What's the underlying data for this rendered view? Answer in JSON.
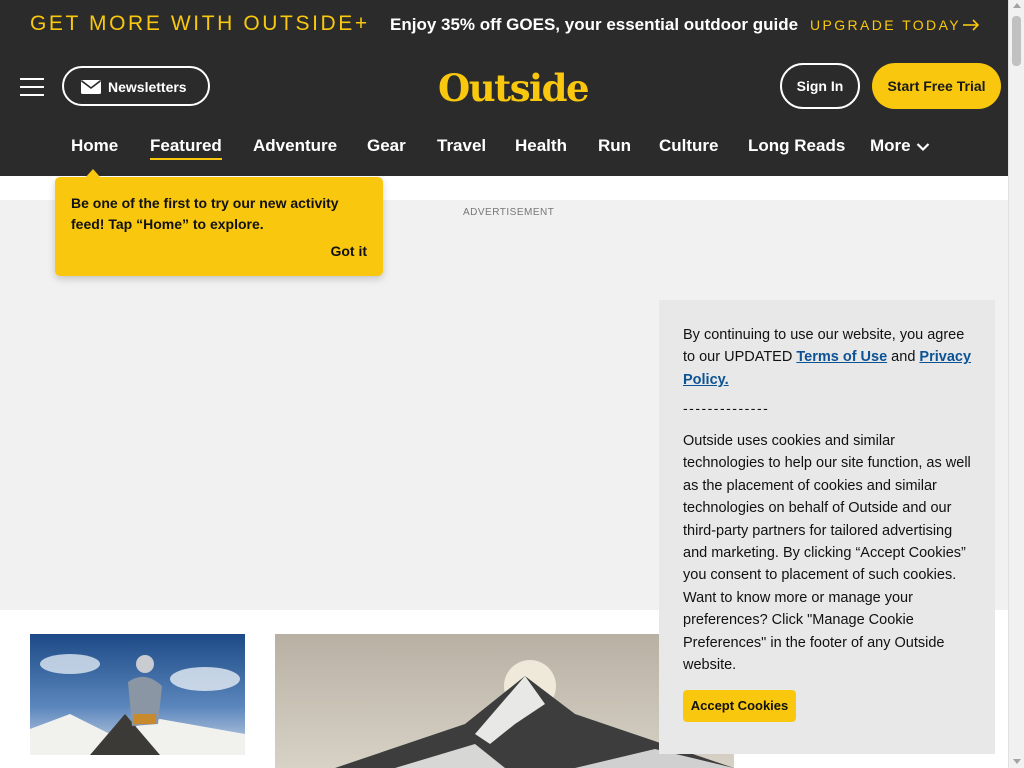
{
  "promo": {
    "left_text": "GET MORE WITH OUTSIDE+",
    "middle_text": "Enjoy 35% off GOES, your essential outdoor guide",
    "cta": "UPGRADE TODAY"
  },
  "header": {
    "newsletters_label": "Newsletters",
    "logo_text": "Outside",
    "signin_label": "Sign In",
    "trial_label": "Start Free Trial"
  },
  "nav": {
    "items": [
      {
        "label": "Home"
      },
      {
        "label": "Featured"
      },
      {
        "label": "Adventure"
      },
      {
        "label": "Gear"
      },
      {
        "label": "Travel"
      },
      {
        "label": "Health"
      },
      {
        "label": "Run"
      },
      {
        "label": "Culture"
      },
      {
        "label": "Long Reads"
      },
      {
        "label": "More"
      }
    ],
    "active": "Featured"
  },
  "ad": {
    "label": "ADVERTISEMENT"
  },
  "tooltip": {
    "message": "Be one of the first to try our new activity feed! Tap “Home” to explore.",
    "dismiss": "Got it"
  },
  "cookie": {
    "intro_prefix": "By continuing to use our website, you agree to our UPDATED ",
    "terms_link": "Terms of Use",
    "and_text": " and ",
    "privacy_link": "Privacy Policy.",
    "divider": "--------------",
    "body": "Outside uses cookies and similar technologies to help our site function, as well as the placement of cookies and similar technologies on behalf of Outside and our third-party partners for tailored advertising and marketing. By clicking “Accept Cookies” you consent to placement of such cookies. Want to know more or manage your preferences? Click \"Manage Cookie Preferences\" in the footer of any Outside website.",
    "accept_label": "Accept Cookies"
  },
  "colors": {
    "brand_yellow": "#f9c80e",
    "header_bg": "#2b2b2b",
    "link_blue": "#0b5394"
  }
}
